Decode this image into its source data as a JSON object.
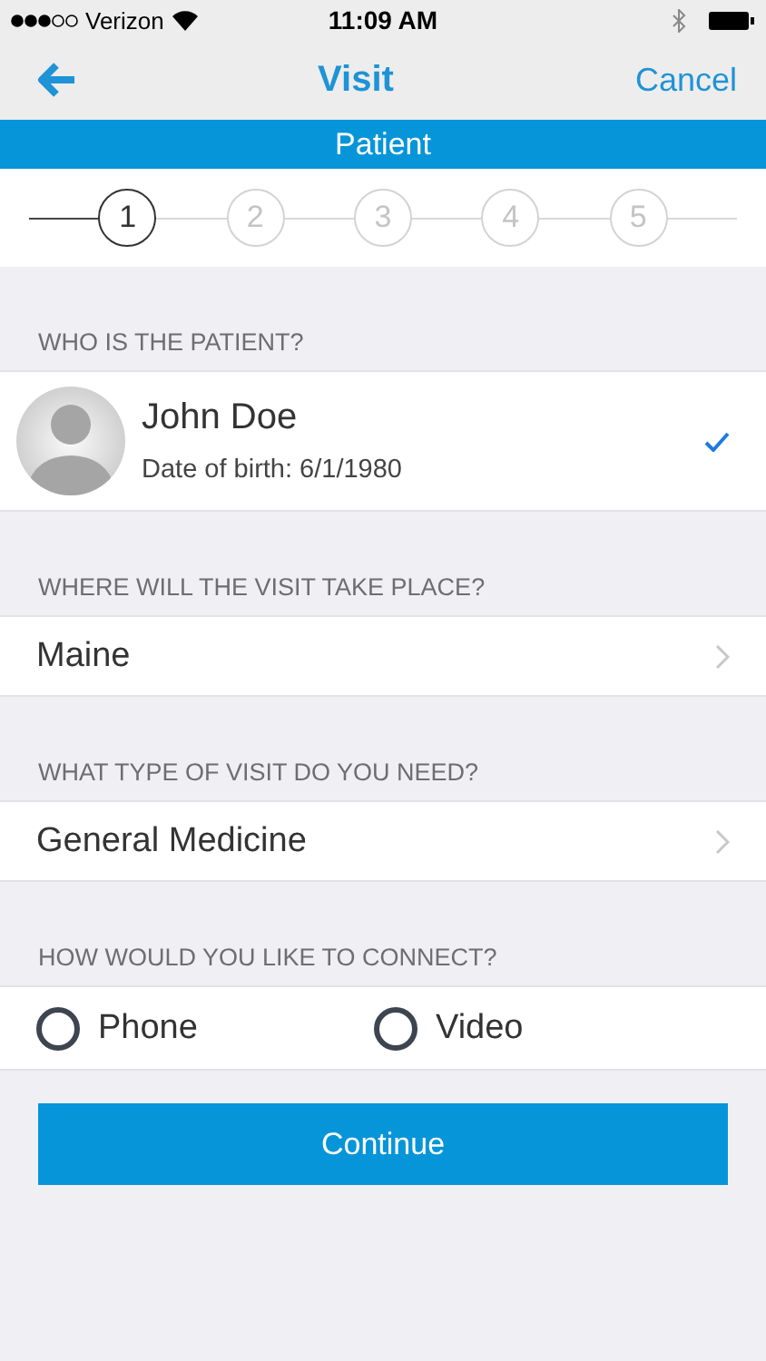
{
  "status_bar": {
    "carrier": "Verizon",
    "time": "11:09 AM"
  },
  "nav": {
    "title": "Visit",
    "cancel": "Cancel"
  },
  "banner": {
    "title": "Patient"
  },
  "steps": [
    {
      "label": "1",
      "selected": true
    },
    {
      "label": "2",
      "selected": false
    },
    {
      "label": "3",
      "selected": false
    },
    {
      "label": "4",
      "selected": false
    },
    {
      "label": "5",
      "selected": false
    }
  ],
  "sections": [
    {
      "header": "WHO IS THE PATIENT?",
      "kind": "patient",
      "name": "John Doe",
      "detail": "Date of birth: 6/1/1980",
      "selected": true
    },
    {
      "header": "WHERE WILL THE VISIT TAKE PLACE?",
      "kind": "picker",
      "value": "Maine"
    },
    {
      "header": "WHAT TYPE OF VISIT DO YOU NEED?",
      "kind": "picker",
      "value": "General Medicine"
    },
    {
      "header": "HOW WOULD YOU LIKE TO CONNECT?",
      "kind": "radio",
      "options": [
        {
          "label": "Phone",
          "selected": false
        },
        {
          "label": "Video",
          "selected": false
        }
      ]
    }
  ],
  "continue_button": "Continue"
}
